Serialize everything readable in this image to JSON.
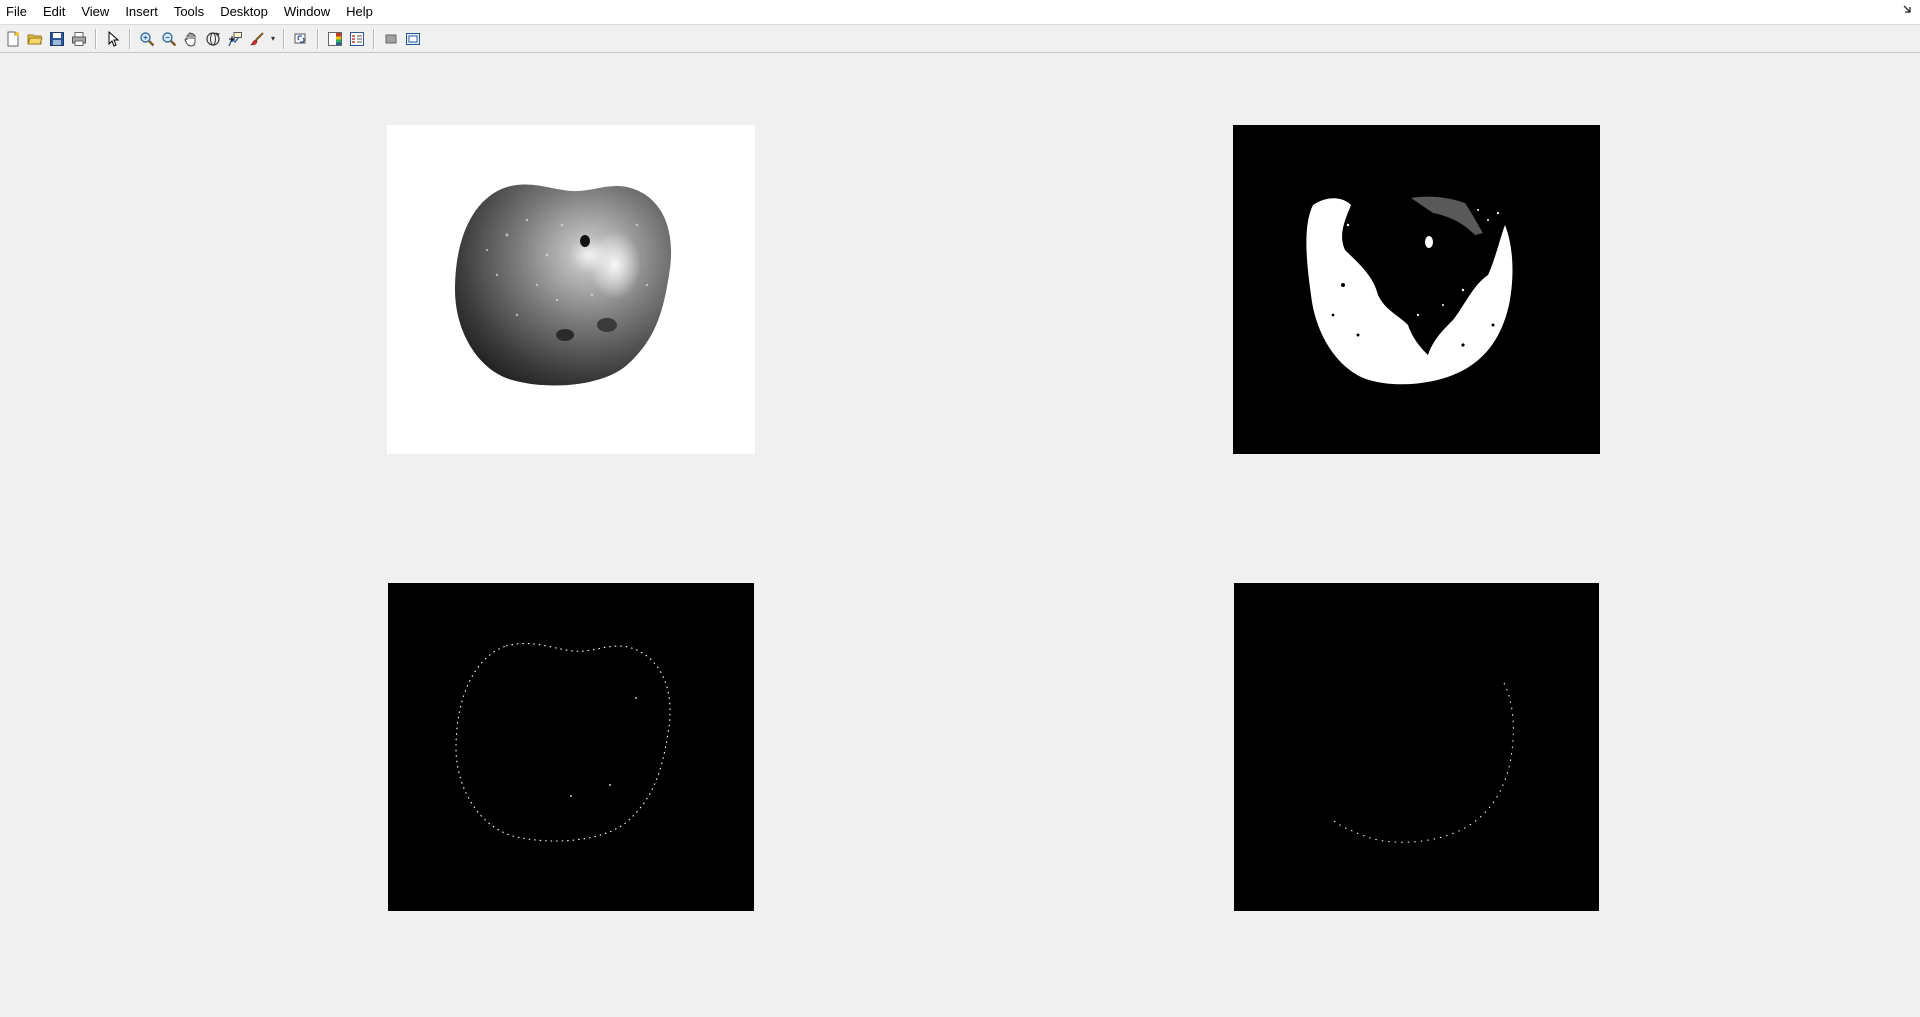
{
  "window": {
    "menu": [
      "File",
      "Edit",
      "View",
      "Insert",
      "Tools",
      "Desktop",
      "Window",
      "Help"
    ],
    "dock_icon": "dock-arrow-icon"
  },
  "toolbar": {
    "buttons": [
      "new-figure-icon",
      "open-file-icon",
      "save-figure-icon",
      "print-figure-icon",
      "edit-plot-icon",
      "zoom-in-icon",
      "zoom-out-icon",
      "pan-icon",
      "rotate-3d-icon",
      "data-cursor-icon",
      "brush-icon",
      "link-plot-icon",
      "insert-colorbar-icon",
      "insert-legend-icon",
      "hide-plot-tools-icon",
      "show-plot-tools-icon"
    ]
  },
  "figure": {
    "panels": [
      {
        "name": "grayscale-apple",
        "background": "#ffffff"
      },
      {
        "name": "binary-threshold",
        "background": "#000000"
      },
      {
        "name": "edge-map-full",
        "background": "#000000"
      },
      {
        "name": "edge-map-partial",
        "background": "#000000"
      }
    ]
  }
}
